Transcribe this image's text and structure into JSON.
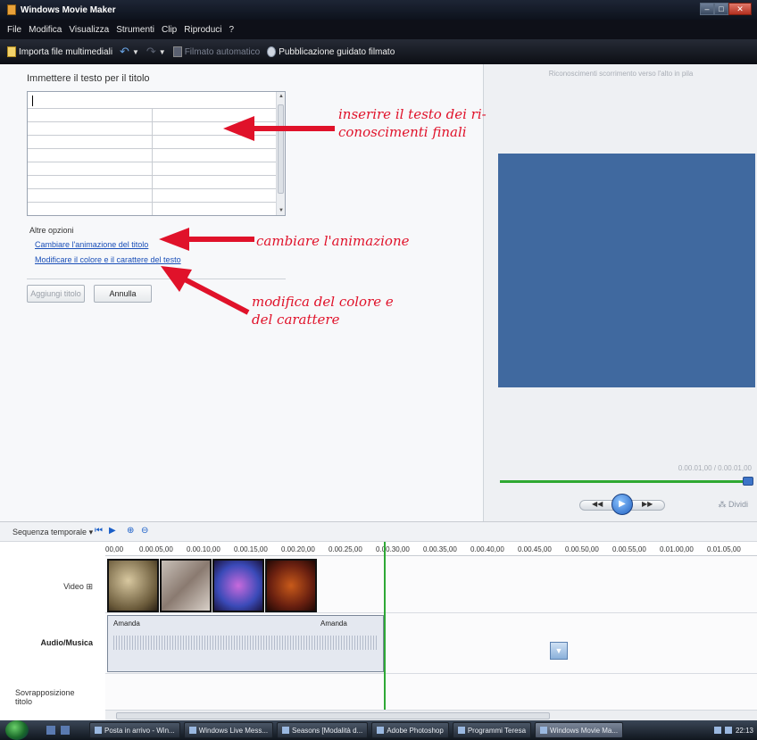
{
  "window": {
    "title": "Windows Movie Maker"
  },
  "menu": [
    "File",
    "Modifica",
    "Visualizza",
    "Strumenti",
    "Clip",
    "Riproduci",
    "?"
  ],
  "toolbar": {
    "import": "Importa file multimediali",
    "automovie": "Filmato automatico",
    "publish": "Pubblicazione guidato filmato"
  },
  "task": {
    "heading": "Immettere il testo per il titolo",
    "other_options": "Altre opzioni",
    "link_animation": "Cambiare l'animazione del titolo",
    "link_font": "Modificare il colore e il carattere del testo",
    "add_button": "Aggiungi titolo",
    "cancel_button": "Annulla"
  },
  "annotations": {
    "a1_line1": "inserire il testo dei ri-",
    "a1_line2": "conoscimenti finali",
    "a2": "cambiare l'animazione",
    "a3_line1": "modifica del colore e",
    "a3_line2": "del carattere",
    "color": "#e0122a"
  },
  "preview": {
    "caption": "Riconoscimenti scorrimento verso l'alto in pila",
    "time": "0.00.01,00 / 0.00.01,00",
    "split": "Dividi"
  },
  "timeline": {
    "label": "Sequenza temporale",
    "ruler": [
      "00,00",
      "0.00.05,00",
      "0.00.10,00",
      "0.00.15,00",
      "0.00.20,00",
      "0.00.25,00",
      "0.00.30,00",
      "0.00.35,00",
      "0.00.40,00",
      "0.00.45,00",
      "0.00.50,00",
      "0.00.55,00",
      "0.01.00,00",
      "0.01.05,00"
    ],
    "video_label": "Video",
    "audio_label": "Audio/Musica",
    "overlay_label": "Sovrapposizione titolo",
    "audio_clip_1": "Amanda",
    "audio_clip_2": "Amanda"
  },
  "taskbar": [
    "Posta in arrivo - Win...",
    "Windows Live Mess...",
    "Seasons [Modalità d...",
    "Adobe Photoshop",
    "Programmi Teresa",
    "Windows Movie Ma..."
  ],
  "clock": "22:13"
}
